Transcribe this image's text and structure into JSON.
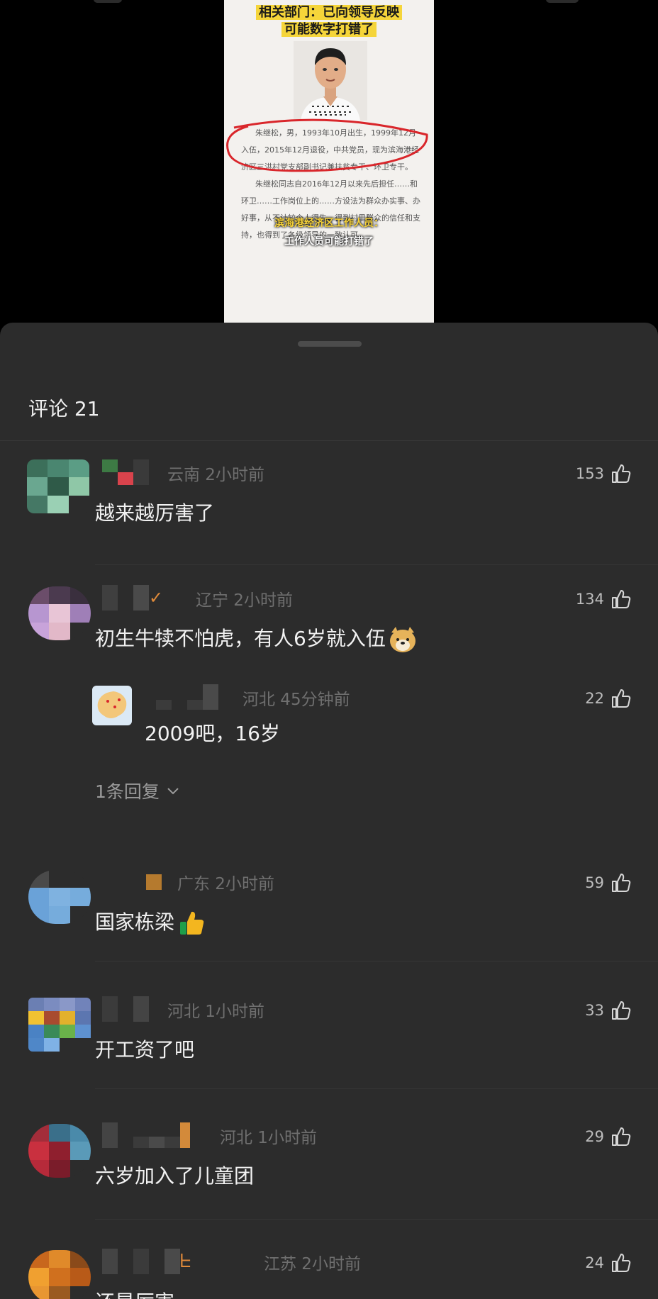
{
  "video": {
    "headline_line1": "相关部门：已向领导反映",
    "headline_line2": "可能数字打错了",
    "article_paragraph1": "朱继松，男，1993年10月出生，1999年12月入伍，2015年12月退役，中共党员，现为滨海港经济区三洪村党支部副书记兼扶贫专干、环卫专干。",
    "article_paragraph2": "朱继松同志自2016年12月以来先后担任……和环卫……工作岗位上的……方设法为群众办实事、办好事，从不计较个人得失，得到村里群众的信任和支持，也得到了各级领导的一致认可。",
    "caption_line1": "滨海港经济区工作人员：",
    "caption_line2": "工作人员可能打错了"
  },
  "comments_header": {
    "title": "评论 21"
  },
  "comments": [
    {
      "location_time": "云南 2小时前",
      "text": "越来越厉害了",
      "likes": "153"
    },
    {
      "location_time": "辽宁 2小时前",
      "text": "初生牛犊不怕虎，有人6岁就入伍",
      "likes": "134",
      "reply": {
        "location_time": "河北 45分钟前",
        "text": "2009吧，16岁",
        "likes": "22"
      },
      "reply_toggle": "1条回复"
    },
    {
      "location_time": "广东 2小时前",
      "text": "国家栋梁",
      "likes": "59"
    },
    {
      "location_time": "河北 1小时前",
      "text": "开工资了吧",
      "likes": "33"
    },
    {
      "location_time": "河北 1小时前",
      "text": "六岁加入了儿童团",
      "likes": "29"
    },
    {
      "location_time": "江苏 2小时前",
      "text": "还是厉害",
      "likes": "24"
    }
  ],
  "icons": {
    "like": "thumb-up-icon",
    "chevron": "chevron-down-icon"
  },
  "colors": {
    "sheet_bg": "#2c2c2c",
    "meta_text": "#6f6f6f",
    "highlight_yellow": "#f5d53a",
    "annotation_red": "#d9262b"
  }
}
